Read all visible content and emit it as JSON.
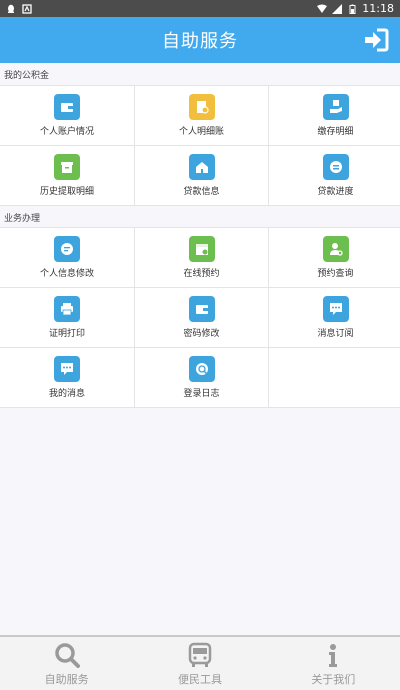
{
  "status_bar": {
    "time": "11:18",
    "icons": [
      "notification-qq-icon",
      "notification-app-icon",
      "wifi-icon",
      "signal-icon",
      "battery-icon"
    ]
  },
  "app_bar": {
    "title": "自助服务",
    "action_icon": "login-icon"
  },
  "sections": [
    {
      "label": "我的公积金",
      "items": [
        {
          "label": "个人账户情况",
          "icon": "wallet-icon",
          "color": "#3da4dd"
        },
        {
          "label": "个人明细账",
          "icon": "ledger-icon",
          "color": "#f1bf3d"
        },
        {
          "label": "缴存明细",
          "icon": "deposit-hand-icon",
          "color": "#3da4dd"
        },
        {
          "label": "历史提取明细",
          "icon": "archive-icon",
          "color": "#6cbf4e"
        },
        {
          "label": "贷款信息",
          "icon": "house-icon",
          "color": "#3da4dd"
        },
        {
          "label": "贷款进度",
          "icon": "progress-icon",
          "color": "#3da4dd"
        }
      ]
    },
    {
      "label": "业务办理",
      "items": [
        {
          "label": "个人信息修改",
          "icon": "edit-info-icon",
          "color": "#3da4dd"
        },
        {
          "label": "在线预约",
          "icon": "calendar-icon",
          "color": "#6cbf4e"
        },
        {
          "label": "预约查询",
          "icon": "user-search-icon",
          "color": "#6cbf4e"
        },
        {
          "label": "证明打印",
          "icon": "printer-icon",
          "color": "#3da4dd"
        },
        {
          "label": "密码修改",
          "icon": "password-icon",
          "color": "#3da4dd"
        },
        {
          "label": "消息订阅",
          "icon": "message-subscribe-icon",
          "color": "#3da4dd"
        },
        {
          "label": "我的消息",
          "icon": "chat-icon",
          "color": "#3da4dd"
        },
        {
          "label": "登录日志",
          "icon": "log-icon",
          "color": "#3da4dd"
        }
      ]
    }
  ],
  "bottom_nav": [
    {
      "label": "自助服务",
      "icon": "search-icon"
    },
    {
      "label": "便民工具",
      "icon": "bus-icon"
    },
    {
      "label": "关于我们",
      "icon": "info-icon"
    }
  ]
}
